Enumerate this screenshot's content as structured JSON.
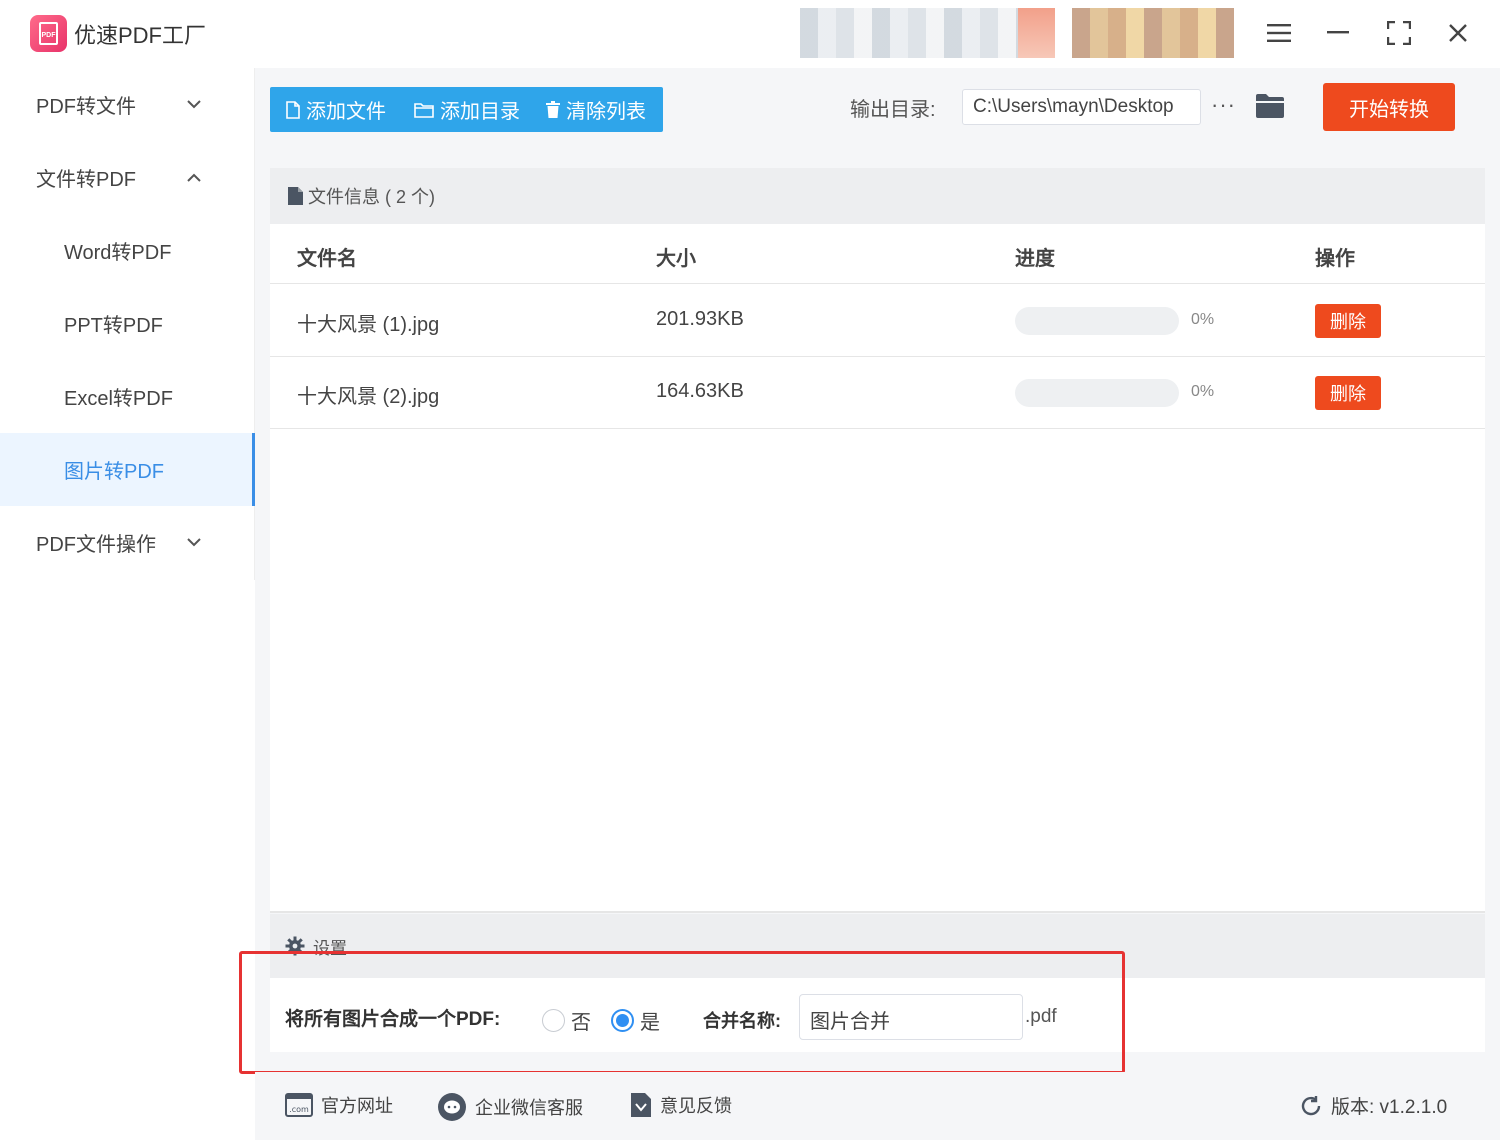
{
  "app": {
    "title": "优速PDF工厂",
    "logo_text": "PDF"
  },
  "sidebar": {
    "items": [
      {
        "label": "PDF转文件",
        "chevron": "⌄"
      },
      {
        "label": "文件转PDF",
        "chevron": "⌃"
      },
      {
        "label": "Word转PDF"
      },
      {
        "label": "PPT转PDF"
      },
      {
        "label": "Excel转PDF"
      },
      {
        "label": "图片转PDF",
        "active": true
      },
      {
        "label": "PDF文件操作",
        "chevron": "⌄"
      }
    ]
  },
  "toolbar": {
    "add_file": "添加文件",
    "add_dir": "添加目录",
    "clear_list": "清除列表",
    "output_label": "输出目录:",
    "output_path": "C:\\Users\\mayn\\Desktop",
    "more": "···",
    "start": "开始转换"
  },
  "file_panel": {
    "header": "文件信息 ( 2 个)",
    "columns": [
      "文件名",
      "大小",
      "进度",
      "操作"
    ],
    "rows": [
      {
        "name": "十大风景 (1).jpg",
        "size": "201.93KB",
        "progress": 0,
        "progress_text": "0%",
        "action": "删除"
      },
      {
        "name": "十大风景 (2).jpg",
        "size": "164.63KB",
        "progress": 0,
        "progress_text": "0%",
        "action": "删除"
      }
    ]
  },
  "settings": {
    "header": "设置",
    "merge_label": "将所有图片合成一个PDF:",
    "option_no": "否",
    "option_yes": "是",
    "selected": "是",
    "name_label": "合并名称:",
    "name_value": "图片合并",
    "ext": ".pdf"
  },
  "footer": {
    "website": "官方网址",
    "wechat": "企业微信客服",
    "feedback": "意见反馈",
    "version": "版本:  v1.2.1.0"
  },
  "colors": {
    "accent": "#2fa5ea",
    "danger": "#ee4a1e",
    "highlight": "#e63232",
    "active_nav": "#3a8ee6"
  }
}
